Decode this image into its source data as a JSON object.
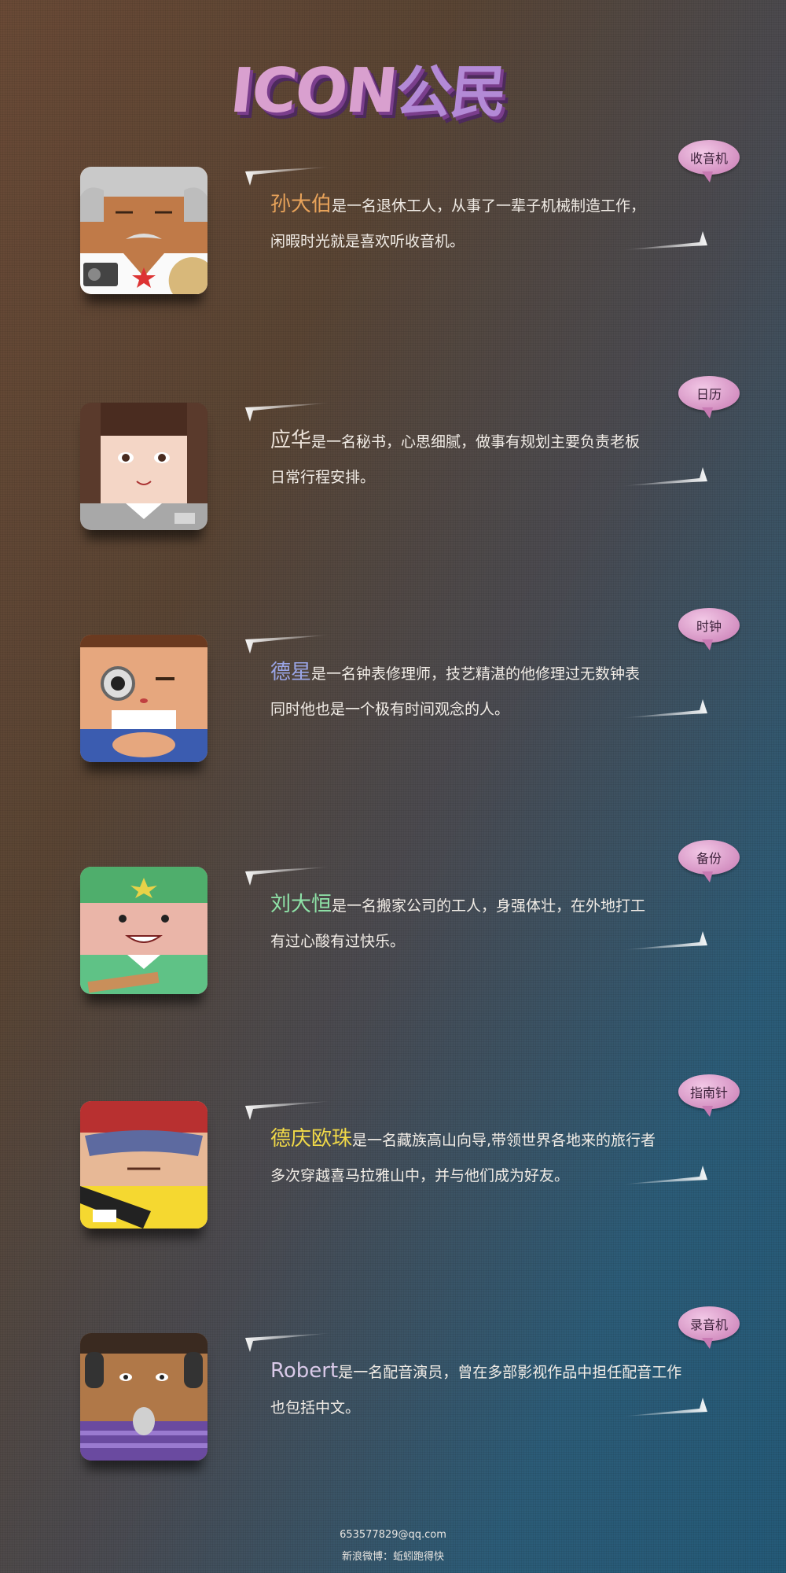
{
  "logo": {
    "latin": "ICON",
    "cn": "公民"
  },
  "people": [
    {
      "tag": "收音机",
      "name": "孙大伯",
      "name_color": "#e8a35a",
      "line1": "是一名退休工人，从事了一辈子机械制造工作，",
      "line2": "闲暇时光就是喜欢听收音机。",
      "avatar_icon": "old-man-radio-icon"
    },
    {
      "tag": "日历",
      "name": "应华",
      "name_color": "#e9dfd6",
      "line1": "是一名秘书，心思细腻，做事有规划主要负责老板",
      "line2": "日常行程安排。",
      "avatar_icon": "secretary-calendar-icon"
    },
    {
      "tag": "时钟",
      "name": "德星",
      "name_color": "#9aa5e6",
      "line1": "是一名钟表修理师，技艺精湛的他修理过无数钟表",
      "line2": "同时他也是一个极有时间观念的人。",
      "avatar_icon": "watchmaker-clock-icon"
    },
    {
      "tag": "备份",
      "name": "刘大恒",
      "name_color": "#8fe3a8",
      "line1": "是一名搬家公司的工人，身强体壮，在外地打工",
      "line2": "有过心酸有过快乐。",
      "avatar_icon": "mover-backup-icon"
    },
    {
      "tag": "指南针",
      "name": "德庆欧珠",
      "name_color": "#f0d848",
      "line1": "是一名藏族高山向导,带领世界各地来的旅行者",
      "line2": "多次穿越喜马拉雅山中，并与他们成为好友。",
      "avatar_icon": "mountain-guide-compass-icon"
    },
    {
      "tag": "录音机",
      "name": "Robert",
      "name_color": "#d9c9e8",
      "line1": "是一名配音演员，曾在多部影视作品中担任配音工作",
      "line2": "也包括中文。",
      "avatar_icon": "voice-actor-recorder-icon"
    }
  ],
  "footer": {
    "email": "653577829@qq.com",
    "weibo": "新浪微博：蚯蚓跑得快"
  }
}
